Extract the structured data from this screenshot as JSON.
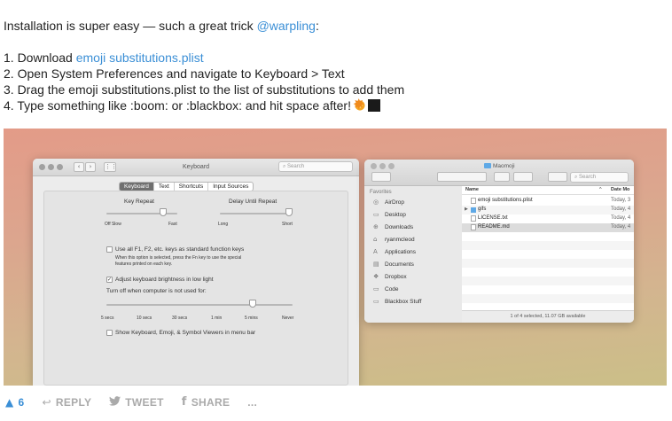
{
  "post": {
    "intro": "Installation is super easy — such a great trick ",
    "mention": "@warpling",
    "intro_end": ":",
    "step1_prefix": "1. Download ",
    "step1_link": "emoji substitutions.plist",
    "step2": "2. Open System Preferences and navigate to Keyboard > Text",
    "step3": "3. Drag the emoji substitutions.plist to the list of substitutions to add them",
    "step4": "4. Type something like :boom: or :blackbox: and hit space after!"
  },
  "keyboard_window": {
    "title": "Keyboard",
    "search_placeholder": "Search",
    "tabs": [
      "Keyboard",
      "Text",
      "Shortcuts",
      "Input Sources"
    ],
    "key_repeat_label": "Key Repeat",
    "key_repeat_min": "Off  Slow",
    "key_repeat_max": "Fast",
    "delay_label": "Delay Until Repeat",
    "delay_min": "Long",
    "delay_max": "Short",
    "fn_keys_label": "Use all F1, F2, etc. keys as standard function keys",
    "fn_keys_desc_1": "When this option is selected, press the Fn key to use the special",
    "fn_keys_desc_2": "features printed on each key.",
    "brightness_label": "Adjust keyboard brightness in low light",
    "turn_off_label": "Turn off when computer is not used for:",
    "ticks": [
      "5 secs",
      "10 secs",
      "30 secs",
      "1 min",
      "5 mins",
      "Never"
    ],
    "viewers_label": "Show Keyboard, Emoji, & Symbol Viewers in menu bar",
    "checked_mark": "✓"
  },
  "finder_window": {
    "folder": "Maomoji",
    "search_placeholder": "Search",
    "favorites_label": "Favorites",
    "sidebar": [
      {
        "icon": "◎",
        "label": "AirDrop"
      },
      {
        "icon": "▭",
        "label": "Desktop"
      },
      {
        "icon": "⊕",
        "label": "Downloads"
      },
      {
        "icon": "⌂",
        "label": "ryanmcleod"
      },
      {
        "icon": "A",
        "label": "Applications"
      },
      {
        "icon": "▤",
        "label": "Documents"
      },
      {
        "icon": "❖",
        "label": "Dropbox"
      },
      {
        "icon": "▭",
        "label": "Code"
      },
      {
        "icon": "▭",
        "label": "Blackbox Stuff"
      }
    ],
    "col_name": "Name",
    "col_date": "Date Mo",
    "files": [
      {
        "name": "emoji substitutions.plist",
        "date": "Today, 3",
        "kind": "doc"
      },
      {
        "name": "gifs",
        "date": "Today, 4",
        "kind": "dir"
      },
      {
        "name": "LICENSE.txt",
        "date": "Today, 4",
        "kind": "doc"
      },
      {
        "name": "README.md",
        "date": "Today, 4",
        "kind": "doc"
      }
    ],
    "status": "1 of 4 selected, 11.07 GB available"
  },
  "actions": {
    "vote_count": "6",
    "reply": "REPLY",
    "tweet": "TWEET",
    "share": "SHARE",
    "more": "..."
  },
  "colors": {
    "link": "#3b8fd6",
    "action_gray": "#aaaaaa"
  },
  "icons": {
    "vote": "▲",
    "reply": "↩",
    "tweet": "twitter-bird",
    "share": "f"
  }
}
